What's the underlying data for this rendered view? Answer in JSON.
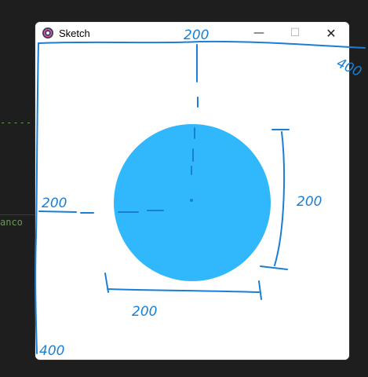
{
  "editor": {
    "dashes": "-----",
    "partial_word": "anco"
  },
  "window": {
    "title": "Sketch",
    "controls": {
      "minimize": "—",
      "maximize": "☐",
      "close": "✕"
    }
  },
  "sketch": {
    "circle_color": "#31b7fb",
    "annotation_color": "#1a7fd4",
    "annotations": {
      "top": "200",
      "top_right": "400",
      "left": "200",
      "right": "200",
      "bottom": "200",
      "bottom_left": "400"
    }
  }
}
